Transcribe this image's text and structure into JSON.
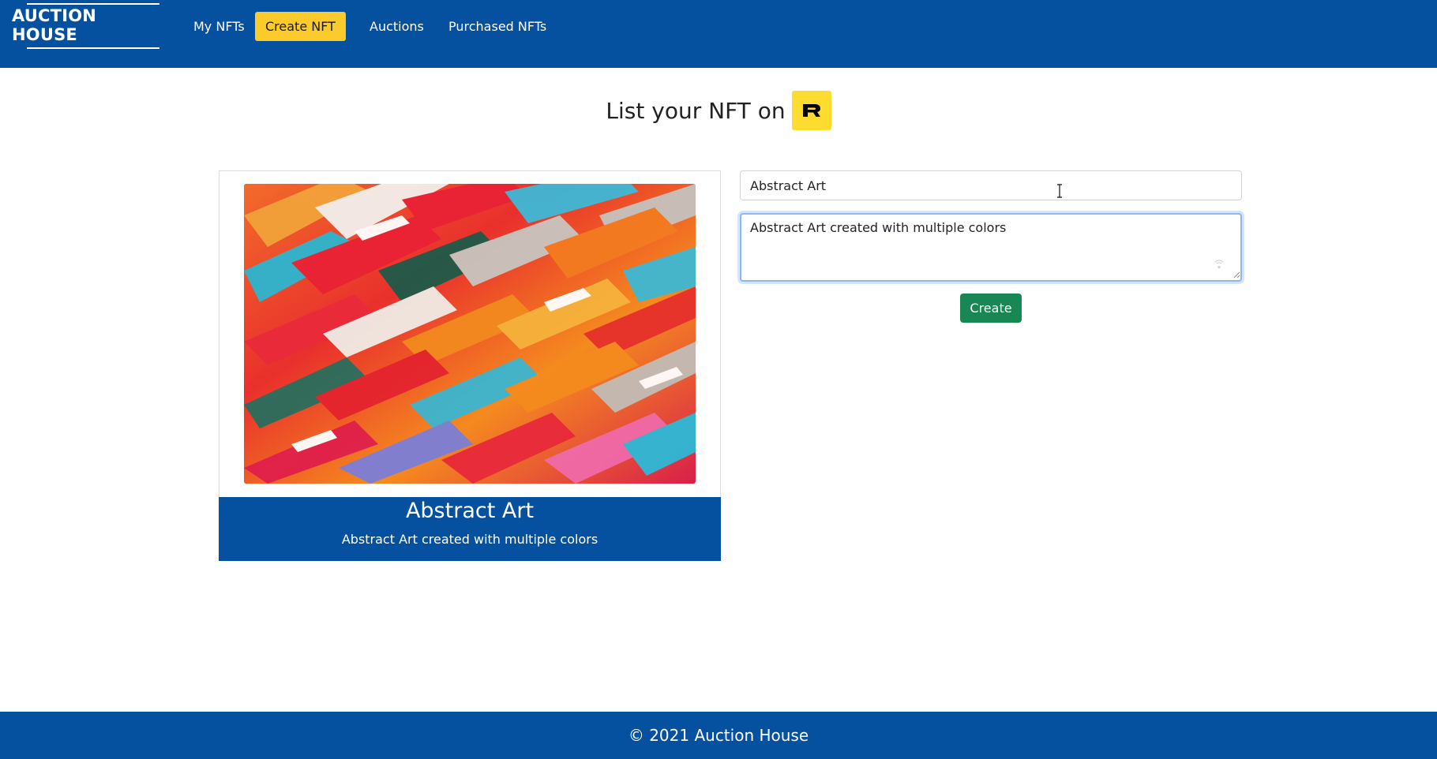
{
  "nav": {
    "brand": "AUCTION HOUSE",
    "links": [
      {
        "label": "My NFTs",
        "active": false
      },
      {
        "label": "Create NFT",
        "active": true
      },
      {
        "label": "Auctions",
        "active": false
      },
      {
        "label": "Purchased NFTs",
        "active": false
      }
    ]
  },
  "page": {
    "title": "List your NFT on",
    "logo_icon": "rarible-logo-icon"
  },
  "preview": {
    "title": "Abstract Art",
    "description": "Abstract Art created with multiple colors"
  },
  "form": {
    "name_value": "Abstract Art",
    "description_value": "Abstract Art created with multiple colors",
    "submit_label": "Create"
  },
  "footer": {
    "text": "© 2021 Auction House"
  },
  "colors": {
    "navbar": "#06519f",
    "active_link": "#fbcb2b",
    "button": "#198754",
    "logo_bg": "#fedb2f"
  }
}
